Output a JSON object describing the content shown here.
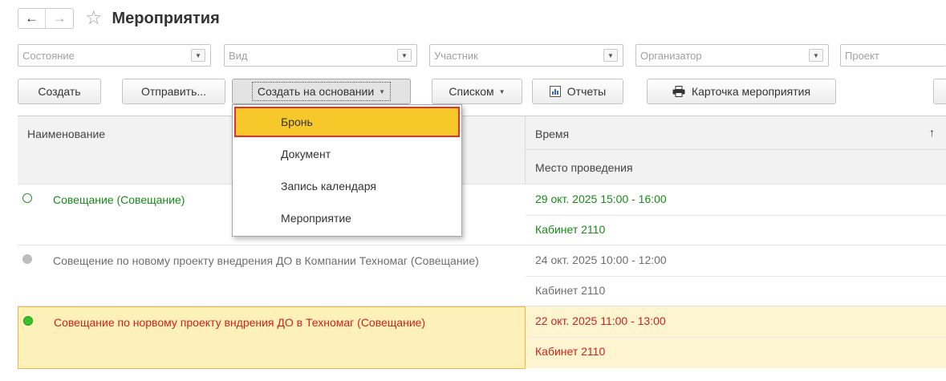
{
  "window": {
    "title": "Мероприятия"
  },
  "nav": {
    "back": "←",
    "forward": "→",
    "star": "☆"
  },
  "filters": [
    {
      "placeholder": "Состояние"
    },
    {
      "placeholder": "Вид"
    },
    {
      "placeholder": "Участник"
    },
    {
      "placeholder": "Организатор"
    },
    {
      "placeholder": "Проект"
    }
  ],
  "toolbar": {
    "create": "Создать",
    "send": "Отправить...",
    "create_based_on": "Создать на основании",
    "list_view": "Списком",
    "reports": "Отчеты",
    "event_card": "Карточка мероприятия"
  },
  "dropdown_menu": {
    "items": [
      "Бронь",
      "Документ",
      "Запись календаря",
      "Мероприятие"
    ],
    "selected": "Бронь"
  },
  "table": {
    "columns": {
      "name": "Наименование",
      "time": "Время",
      "place": "Место проведения",
      "sort_indicator": "↑"
    },
    "rows": [
      {
        "name": "Совещание  (Совещание)",
        "time": "29 окт. 2025 15:00 - 16:00",
        "place": "Кабинет 2110",
        "status_color": "#2e8b2e"
      },
      {
        "name": "Совещение по новому проекту внедрения ДО в Компании Техномаг (Совещание)",
        "time": "24 окт. 2025 10:00 - 12:00",
        "place": "Кабинет 2110",
        "status_color": "#bdbdbd"
      },
      {
        "name": "Совещание по норвому проекту вндрения ДО в Техномаг (Совещание)",
        "time": "22 окт. 2025 11:00 - 13:00",
        "place": "Кабинет 2110",
        "status_color": "#3bbf2c"
      }
    ]
  },
  "colors": {
    "menu_highlight": "#f7c829",
    "highlight_border": "#e33030",
    "selected_row": "#fdf0b8",
    "upcoming_text": "#178a17",
    "past_text": "#6e6e6e",
    "current_text": "#cc2222"
  }
}
